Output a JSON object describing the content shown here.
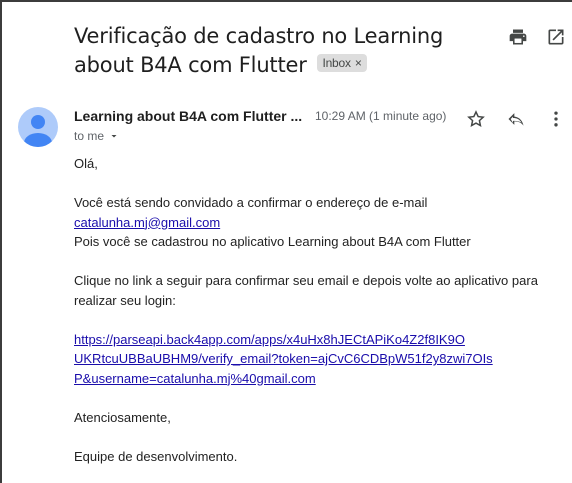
{
  "email": {
    "subject": "Verificação de cadastro no Learning about B4A com Flutter",
    "label_chip": "Inbox",
    "sender_name": "Learning about B4A com Flutter",
    "sender_truncated": "Learning about B4A com Flutter ...",
    "time": "10:29 AM (1 minute ago)",
    "recipient": "to me"
  },
  "body": {
    "greeting": "Olá,",
    "line1": "Você está sendo convidado a confirmar o endereço de e-mail",
    "email_link": "catalunha.mj@gmail.com",
    "line2": "Pois você se cadastrou no aplicativo Learning about B4A com Flutter",
    "line3": "Clique no link a seguir para confirmar seu email e depois volte ao aplicativo para realizar seu login:",
    "verify_link_1": "https://parseapi.back4app.com/apps/x4uHx8hJECtAPiKo4Z2f8IK9O",
    "verify_link_2": "UKRtcuUBBaUBHM9/verify_email?token=ajCvC6CDBpW51f2y8zwi7OIs",
    "verify_link_3": "P&username=catalunha.mj%40gmail.com",
    "closing": "Atenciosamente,",
    "signature": "Equipe de desenvolvimento."
  },
  "icons": {
    "print": "print-icon",
    "open_new": "open-in-new-icon",
    "star": "star-icon",
    "reply": "reply-icon",
    "more": "more-vert-icon",
    "avatar": "avatar-icon",
    "dropdown": "chevron-down-icon",
    "chip_close": "close-icon"
  },
  "colors": {
    "link": "#1a0dab",
    "avatar_bg": "#aecbfa",
    "avatar_fg": "#4285f4",
    "chip_bg": "#dddddd"
  }
}
